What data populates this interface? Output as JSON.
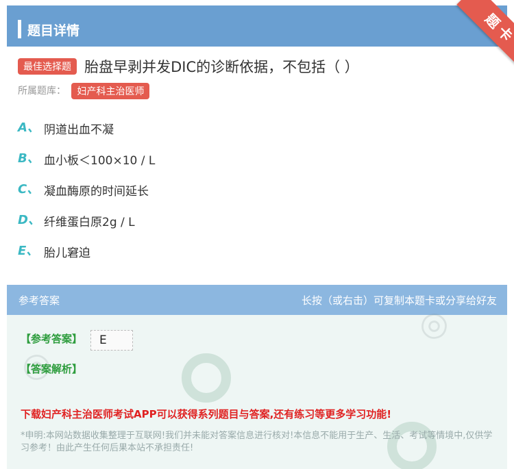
{
  "header": {
    "title": "题目详情",
    "ribbon_label": "题卡"
  },
  "question": {
    "type_tag": "最佳选择题",
    "text": "胎盘早剥并发DIC的诊断依据，不包括（ ）",
    "bank_label": "所属题库：",
    "bank_name": "妇产科主治医师"
  },
  "options": [
    {
      "letter": "A、",
      "text": "阴道出血不凝"
    },
    {
      "letter": "B、",
      "text": "血小板＜100×10 / L"
    },
    {
      "letter": "C、",
      "text": "凝血酶原的时间延长"
    },
    {
      "letter": "D、",
      "text": "纤维蛋白原2g / L"
    },
    {
      "letter": "E、",
      "text": "胎儿窘迫"
    }
  ],
  "answer": {
    "header_left": "参考答案",
    "header_right": "长按（或右击）可复制本题卡或分享给好友",
    "answer_label": "【参考答案】",
    "answer_value": "E",
    "explanation_label": "【答案解析】",
    "promo": "下载妇产科主治医师考试APP可以获得系列题目与答案,还有练习等更多学习功能!",
    "disclaimer": "*申明:本网站数据收集整理于互联网!我们并未能对答案信息进行核对!本信息不能用于生产、生活、考试等情境中,仅供学习参考！由此产生任何后果本站不承担责任!"
  },
  "colors": {
    "header_blue": "#6a9fd1",
    "tag_red": "#e45b4f",
    "option_teal": "#3bb8c3",
    "answer_green": "#2c9c3c",
    "promo_red": "#e02222"
  }
}
